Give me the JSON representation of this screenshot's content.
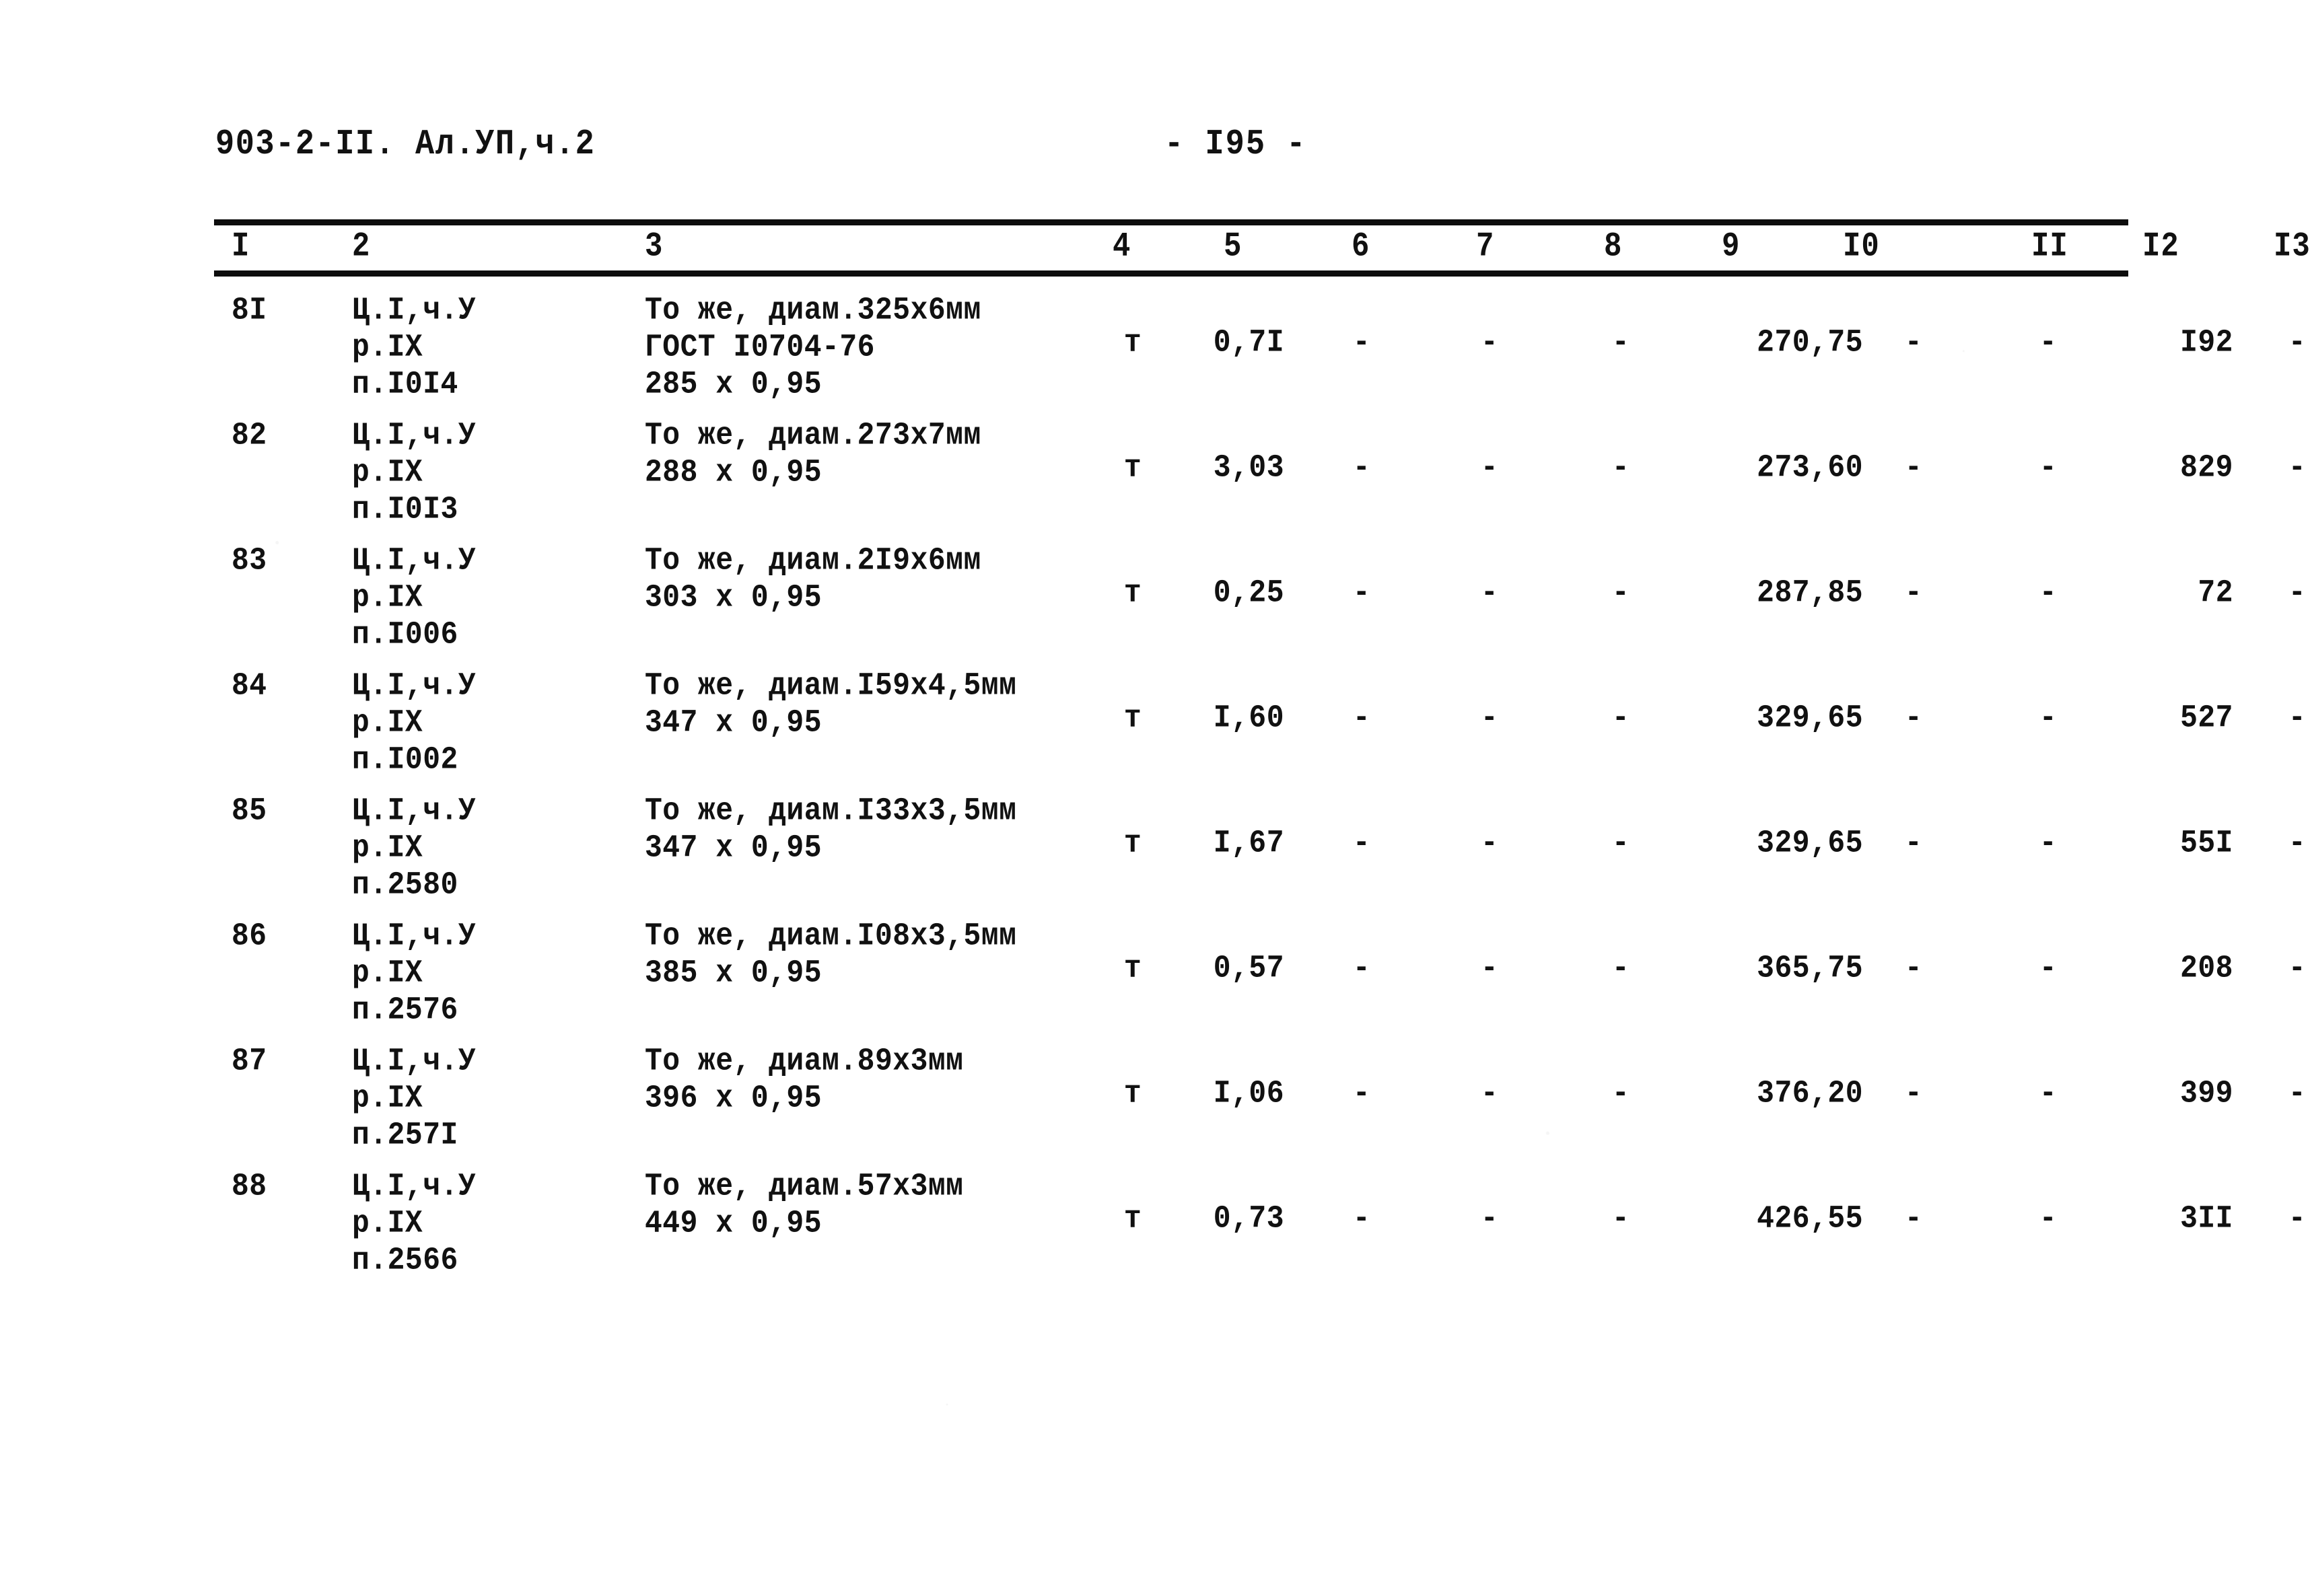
{
  "header": {
    "doc_code": "903-2-II. Ал.УП,ч.2",
    "page_number": "- I95 -"
  },
  "table": {
    "column_numbers": [
      "I",
      "2",
      "3",
      "4",
      "5",
      "6",
      "7",
      "8",
      "9",
      "I0",
      "II",
      "I2",
      "I3"
    ],
    "rows": [
      {
        "num": "8I",
        "ref_lines": "Ц.I,ч.У\nр.IX\nп.I0I4",
        "desc_lines": "То же, диам.325х6мм\nГОСТ I0704-76\n285 х 0,95",
        "unit": "т",
        "qty": "0,7I",
        "c6": "-",
        "c7": "-",
        "c8": "-",
        "c9": "270,75",
        "c10": "-",
        "c11": "-",
        "c12": "I92",
        "c13": "-"
      },
      {
        "num": "82",
        "ref_lines": "Ц.I,ч.У\nр.IX\nп.I0I3",
        "desc_lines": "То же, диам.273х7мм\n288 х 0,95",
        "unit": "т",
        "qty": "3,03",
        "c6": "-",
        "c7": "-",
        "c8": "-",
        "c9": "273,60",
        "c10": "-",
        "c11": "-",
        "c12": "829",
        "c13": "-"
      },
      {
        "num": "83",
        "ref_lines": "Ц.I,ч.У\nр.IX\nп.I006",
        "desc_lines": "То же, диам.2I9х6мм\n303 х 0,95",
        "unit": "т",
        "qty": "0,25",
        "c6": "-",
        "c7": "-",
        "c8": "-",
        "c9": "287,85",
        "c10": "-",
        "c11": "-",
        "c12": "72",
        "c13": "-"
      },
      {
        "num": "84",
        "ref_lines": "Ц.I,ч.У\nр.IX\nп.I002",
        "desc_lines": "То же, диам.I59х4,5мм\n347 х 0,95",
        "unit": "т",
        "qty": "I,60",
        "c6": "-",
        "c7": "-",
        "c8": "-",
        "c9": "329,65",
        "c10": "-",
        "c11": "-",
        "c12": "527",
        "c13": "-"
      },
      {
        "num": "85",
        "ref_lines": "Ц.I,ч.У\nр.IX\nп.2580",
        "desc_lines": "То же, диам.I33х3,5мм\n347 х 0,95",
        "unit": "т",
        "qty": "I,67",
        "c6": "-",
        "c7": "-",
        "c8": "-",
        "c9": "329,65",
        "c10": "-",
        "c11": "-",
        "c12": "55I",
        "c13": "-"
      },
      {
        "num": "86",
        "ref_lines": "Ц.I,ч.У\nр.IX\nп.2576",
        "desc_lines": "То же, диам.I08х3,5мм\n385 х 0,95",
        "unit": "т",
        "qty": "0,57",
        "c6": "-",
        "c7": "-",
        "c8": "-",
        "c9": "365,75",
        "c10": "-",
        "c11": "-",
        "c12": "208",
        "c13": "-"
      },
      {
        "num": "87",
        "ref_lines": "Ц.I,ч.У\nр.IX\nп.257I",
        "desc_lines": "То же, диам.89х3мм\n396 х 0,95",
        "unit": "т",
        "qty": "I,06",
        "c6": "-",
        "c7": "-",
        "c8": "-",
        "c9": "376,20",
        "c10": "-",
        "c11": "-",
        "c12": "399",
        "c13": "-"
      },
      {
        "num": "88",
        "ref_lines": "Ц.I,ч.У\nр.IX\nп.2566",
        "desc_lines": "То же, диам.57х3мм\n449 х 0,95",
        "unit": "т",
        "qty": "0,73",
        "c6": "-",
        "c7": "-",
        "c8": "-",
        "c9": "426,55",
        "c10": "-",
        "c11": "-",
        "c12": "3II",
        "c13": "-"
      }
    ]
  }
}
